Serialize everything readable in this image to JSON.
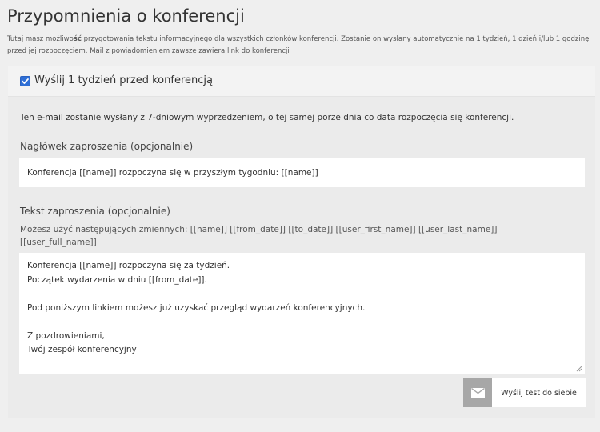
{
  "page": {
    "title": "Przypomnienia o konferencji",
    "description_part1": "Tutaj masz możliwo",
    "description_bold": "ść",
    "description_part2": " przygotowania tekstu informacyjnego dla wszystkich członków konferencji. Zostanie on wysłany automatycznie na 1 tydzień, 1 dzień i/lub 1 godzinę przed jej rozpoczęciem. Mail z powiadomieniem zawsze zawiera link do konferencji"
  },
  "reminder": {
    "checkbox_label": "Wyślij 1 tydzień przed konferencją",
    "checked": true,
    "info_text": "Ten e-mail zostanie wysłany z 7-dniowym wyprzedzeniem, o tej samej porze dnia co data rozpoczęcia się konferencji.",
    "header_label": "Nagłówek zaproszenia (opcjonalnie)",
    "header_value": "Konferencja [[name]] rozpoczyna się w przyszłym tygodniu: [[name]]",
    "text_label": "Tekst zaproszenia (opcjonalnie)",
    "variables_hint": "Możesz użyć następujących zmiennych: [[name]] [[from_date]] [[to_date]] [[user_first_name]] [[user_last_name]] [[user_full_name]]",
    "text_value": "Konferencja [[name]] rozpoczyna się za tydzień.\nPoczątek wydarzenia w dniu [[from_date]].\n\nPod poniższym linkiem możesz już uzyskać przegląd wydarzeń konferencyjnych.\n\nZ pozdrowieniami,\nTwój zespół konferencyjny",
    "test_button_label": "Wyślij test do siebie"
  },
  "colors": {
    "accent": "#2f6fd6",
    "background": "#efefef",
    "button_icon_bg": "#a7a7a7"
  },
  "icons": {
    "checkbox": "checkmark-icon",
    "test_button": "envelope-icon"
  }
}
